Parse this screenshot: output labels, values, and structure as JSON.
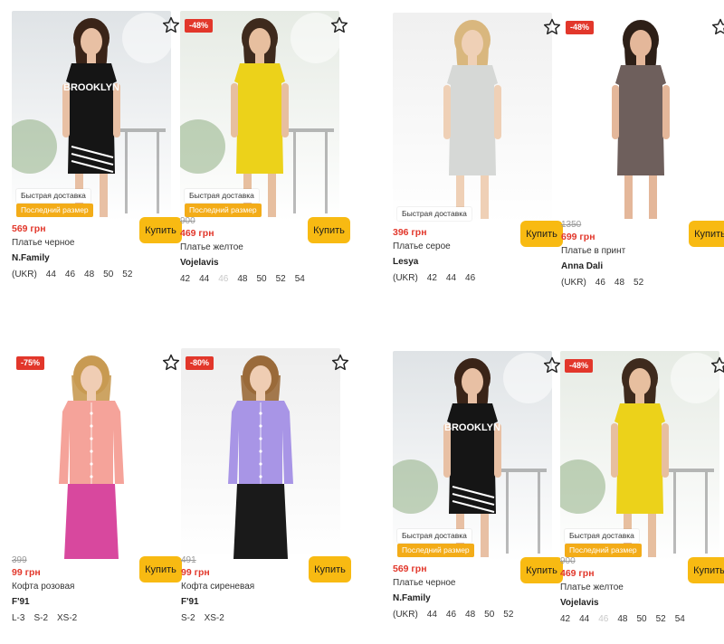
{
  "cards": [
    {
      "discount": "",
      "tags": [
        "Быстрая доставка",
        "Последний размер"
      ],
      "old_price": "",
      "price": "569 грн",
      "name": "Платье черное",
      "brand": "N.Family",
      "sizes_prefix": "(UKR)",
      "sizes": [
        {
          "v": "44",
          "available": true
        },
        {
          "v": "46",
          "available": true
        },
        {
          "v": "48",
          "available": true
        },
        {
          "v": "50",
          "available": true
        },
        {
          "v": "52",
          "available": true
        }
      ],
      "buy_label": "Купить",
      "photo": {
        "bg": "#dfe3e6",
        "garment": "#151515",
        "skin": "#e8c0a4",
        "hair": "#3a2418",
        "kind": "dress",
        "print": "BROOKLYN"
      }
    },
    {
      "discount": "-48%",
      "tags": [
        "Быстрая доставка",
        "Последний размер"
      ],
      "old_price": "900",
      "price": "469 грн",
      "name": "Платье желтое",
      "brand": "Vojelavis",
      "sizes_prefix": "",
      "sizes": [
        {
          "v": "42",
          "available": true
        },
        {
          "v": "44",
          "available": true
        },
        {
          "v": "46",
          "available": false
        },
        {
          "v": "48",
          "available": true
        },
        {
          "v": "50",
          "available": true
        },
        {
          "v": "52",
          "available": true
        },
        {
          "v": "54",
          "available": true
        }
      ],
      "buy_label": "Купить",
      "photo": {
        "bg": "#e6ebe4",
        "garment": "#ecd21a",
        "skin": "#e7bf9f",
        "hair": "#3e2a1d",
        "kind": "dress",
        "print": ""
      }
    },
    {
      "discount": "",
      "tags": [
        "Быстрая доставка"
      ],
      "old_price": "",
      "price": "396 грн",
      "name": "Платье серое",
      "brand": "Lesya",
      "sizes_prefix": "(UKR)",
      "sizes": [
        {
          "v": "42",
          "available": true
        },
        {
          "v": "44",
          "available": true
        },
        {
          "v": "46",
          "available": true
        }
      ],
      "buy_label": "Купить",
      "photo": {
        "bg": "#f0f0f0",
        "garment": "#d6d8d6",
        "skin": "#efd0b6",
        "hair": "#d9b77e",
        "kind": "dress",
        "print": ""
      }
    },
    {
      "discount": "-48%",
      "tags": [],
      "old_price": "1350",
      "price": "699 грн",
      "name": "Платье в принт",
      "brand": "Anna Dali",
      "sizes_prefix": "(UKR)",
      "sizes": [
        {
          "v": "46",
          "available": true
        },
        {
          "v": "48",
          "available": true
        },
        {
          "v": "52",
          "available": true
        }
      ],
      "buy_label": "Купить",
      "photo": {
        "bg": "#ffffff",
        "garment": "#6e5f5c",
        "skin": "#e4b79a",
        "hair": "#2d1f17",
        "kind": "dress",
        "print": ""
      }
    },
    {
      "discount": "-75%",
      "tags": [],
      "old_price": "399",
      "price": "99 грн",
      "name": "Кофта розовая",
      "brand": "F'91",
      "sizes_prefix": "",
      "sizes": [
        {
          "v": "L-3",
          "available": true
        },
        {
          "v": "S-2",
          "available": true
        },
        {
          "v": "XS-2",
          "available": true
        }
      ],
      "buy_label": "Купить",
      "photo": {
        "bg": "#ffffff",
        "garment": "#f5a39a",
        "skin": "#f0cdb4",
        "hair": "#c89a52",
        "kind": "top",
        "pants": "#d8489e",
        "print": ""
      }
    },
    {
      "discount": "-80%",
      "tags": [],
      "old_price": "491",
      "price": "99 грн",
      "name": "Кофта сиреневая",
      "brand": "F'91",
      "sizes_prefix": "",
      "sizes": [
        {
          "v": "S-2",
          "available": true
        },
        {
          "v": "XS-2",
          "available": true
        }
      ],
      "buy_label": "Купить",
      "photo": {
        "bg": "#eeeeee",
        "garment": "#a895e6",
        "skin": "#efcdb3",
        "hair": "#9a6a3a",
        "kind": "top",
        "pants": "#1a1a1a",
        "print": ""
      }
    },
    {
      "discount": "",
      "tags": [
        "Быстрая доставка",
        "Последний размер"
      ],
      "old_price": "",
      "price": "569 грн",
      "name": "Платье черное",
      "brand": "N.Family",
      "sizes_prefix": "(UKR)",
      "sizes": [
        {
          "v": "44",
          "available": true
        },
        {
          "v": "46",
          "available": true
        },
        {
          "v": "48",
          "available": true
        },
        {
          "v": "50",
          "available": true
        },
        {
          "v": "52",
          "available": true
        }
      ],
      "buy_label": "Купить",
      "photo": {
        "bg": "#dfe3e6",
        "garment": "#151515",
        "skin": "#e8c0a4",
        "hair": "#3a2418",
        "kind": "dress",
        "print": "BROOKLYN"
      }
    },
    {
      "discount": "-48%",
      "tags": [
        "Быстрая доставка",
        "Последний размер"
      ],
      "old_price": "900",
      "price": "469 грн",
      "name": "Платье желтое",
      "brand": "Vojelavis",
      "sizes_prefix": "",
      "sizes": [
        {
          "v": "42",
          "available": true
        },
        {
          "v": "44",
          "available": true
        },
        {
          "v": "46",
          "available": false
        },
        {
          "v": "48",
          "available": true
        },
        {
          "v": "50",
          "available": true
        },
        {
          "v": "52",
          "available": true
        },
        {
          "v": "54",
          "available": true
        }
      ],
      "buy_label": "Купить",
      "photo": {
        "bg": "#e6ebe4",
        "garment": "#ecd21a",
        "skin": "#e7bf9f",
        "hair": "#3e2a1d",
        "kind": "dress",
        "print": ""
      }
    }
  ],
  "icons": {
    "favorite": "star-outline-icon"
  },
  "colors": {
    "price": "#e2372b",
    "discount_badge": "#e2372b",
    "buy_button": "#f8ba12",
    "last_size_tag": "#f3ac18",
    "old_price": "#9b9b9b"
  }
}
